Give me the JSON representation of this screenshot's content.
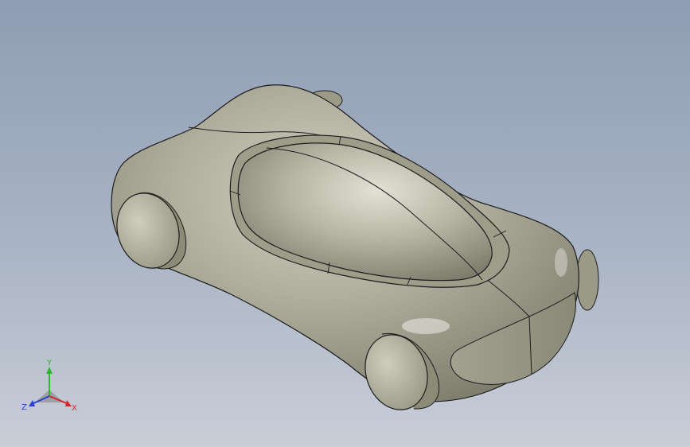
{
  "viewport": {
    "background_top": "#8f9db4",
    "background_bottom": "#c9ced8"
  },
  "model": {
    "body_color": "#a8a796",
    "edge_color": "#1c1c1c",
    "wheel_color": "#b3b29f"
  },
  "triad": {
    "x_label": "X",
    "y_label": "Y",
    "z_label": "Z",
    "x_color": "#d4262a",
    "y_color": "#2fb52f",
    "z_color": "#2a3fd0"
  }
}
